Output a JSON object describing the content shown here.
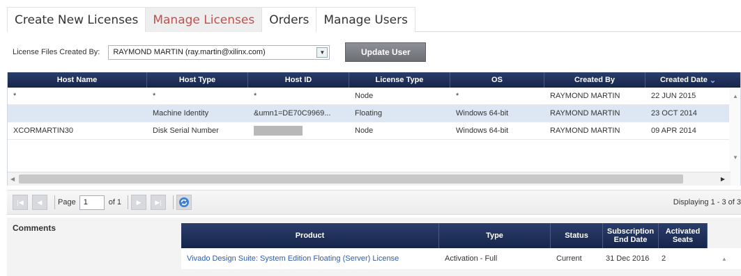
{
  "tabs": [
    {
      "label": "Create New Licenses"
    },
    {
      "label": "Manage Licenses"
    },
    {
      "label": "Orders"
    },
    {
      "label": "Manage Users"
    }
  ],
  "user_filter": {
    "label": "License Files Created By:",
    "value": "RAYMOND MARTIN (ray.martin@xilinx.com)",
    "button": "Update User"
  },
  "grid": {
    "columns": [
      "Host Name",
      "Host Type",
      "Host ID",
      "License Type",
      "OS",
      "Created By",
      "Created Date"
    ],
    "sort_indicator": "⌄",
    "rows": [
      [
        "*",
        "*",
        "*",
        "Node",
        "*",
        "RAYMOND MARTIN",
        "22 JUN 2015"
      ],
      [
        "",
        "Machine Identity",
        "&umn1=DE70C9969...",
        "Floating",
        "Windows 64-bit",
        "RAYMOND MARTIN",
        "23 OCT 2014"
      ],
      [
        "XCORMARTIN30",
        "Disk Serial Number",
        "",
        "Node",
        "Windows 64-bit",
        "RAYMOND MARTIN",
        "09 APR 2014"
      ]
    ],
    "selected_row": 1
  },
  "pager": {
    "page_label": "Page",
    "page_value": "1",
    "of_label": "of 1",
    "display_text": "Displaying 1 - 3 of 3"
  },
  "comments": {
    "label": "Comments"
  },
  "product_grid": {
    "columns": [
      "Product",
      "Type",
      "Status",
      "Subscription End Date",
      "Activated Seats"
    ],
    "rows": [
      [
        "Vivado Design Suite: System Edition Floating (Server) License",
        "Activation - Full",
        "Current",
        "31 Dec 2016",
        "2"
      ]
    ]
  },
  "colors": {
    "header_bg": "#1f2f5a",
    "active_tab_text": "#c0504d",
    "selected_row": "#dde7f3",
    "link": "#2a5db0"
  }
}
